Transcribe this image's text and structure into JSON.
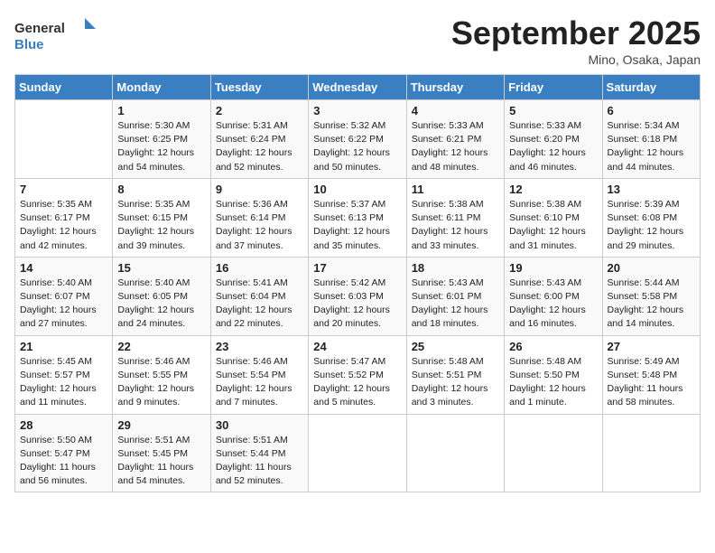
{
  "header": {
    "logo_text_general": "General",
    "logo_text_blue": "Blue",
    "month_title": "September 2025",
    "location": "Mino, Osaka, Japan"
  },
  "days_of_week": [
    "Sunday",
    "Monday",
    "Tuesday",
    "Wednesday",
    "Thursday",
    "Friday",
    "Saturday"
  ],
  "weeks": [
    [
      null,
      {
        "day": 1,
        "sunrise": "5:30 AM",
        "sunset": "6:25 PM",
        "daylight": "12 hours and 54 minutes."
      },
      {
        "day": 2,
        "sunrise": "5:31 AM",
        "sunset": "6:24 PM",
        "daylight": "12 hours and 52 minutes."
      },
      {
        "day": 3,
        "sunrise": "5:32 AM",
        "sunset": "6:22 PM",
        "daylight": "12 hours and 50 minutes."
      },
      {
        "day": 4,
        "sunrise": "5:33 AM",
        "sunset": "6:21 PM",
        "daylight": "12 hours and 48 minutes."
      },
      {
        "day": 5,
        "sunrise": "5:33 AM",
        "sunset": "6:20 PM",
        "daylight": "12 hours and 46 minutes."
      },
      {
        "day": 6,
        "sunrise": "5:34 AM",
        "sunset": "6:18 PM",
        "daylight": "12 hours and 44 minutes."
      }
    ],
    [
      {
        "day": 7,
        "sunrise": "5:35 AM",
        "sunset": "6:17 PM",
        "daylight": "12 hours and 42 minutes."
      },
      {
        "day": 8,
        "sunrise": "5:35 AM",
        "sunset": "6:15 PM",
        "daylight": "12 hours and 39 minutes."
      },
      {
        "day": 9,
        "sunrise": "5:36 AM",
        "sunset": "6:14 PM",
        "daylight": "12 hours and 37 minutes."
      },
      {
        "day": 10,
        "sunrise": "5:37 AM",
        "sunset": "6:13 PM",
        "daylight": "12 hours and 35 minutes."
      },
      {
        "day": 11,
        "sunrise": "5:38 AM",
        "sunset": "6:11 PM",
        "daylight": "12 hours and 33 minutes."
      },
      {
        "day": 12,
        "sunrise": "5:38 AM",
        "sunset": "6:10 PM",
        "daylight": "12 hours and 31 minutes."
      },
      {
        "day": 13,
        "sunrise": "5:39 AM",
        "sunset": "6:08 PM",
        "daylight": "12 hours and 29 minutes."
      }
    ],
    [
      {
        "day": 14,
        "sunrise": "5:40 AM",
        "sunset": "6:07 PM",
        "daylight": "12 hours and 27 minutes."
      },
      {
        "day": 15,
        "sunrise": "5:40 AM",
        "sunset": "6:05 PM",
        "daylight": "12 hours and 24 minutes."
      },
      {
        "day": 16,
        "sunrise": "5:41 AM",
        "sunset": "6:04 PM",
        "daylight": "12 hours and 22 minutes."
      },
      {
        "day": 17,
        "sunrise": "5:42 AM",
        "sunset": "6:03 PM",
        "daylight": "12 hours and 20 minutes."
      },
      {
        "day": 18,
        "sunrise": "5:43 AM",
        "sunset": "6:01 PM",
        "daylight": "12 hours and 18 minutes."
      },
      {
        "day": 19,
        "sunrise": "5:43 AM",
        "sunset": "6:00 PM",
        "daylight": "12 hours and 16 minutes."
      },
      {
        "day": 20,
        "sunrise": "5:44 AM",
        "sunset": "5:58 PM",
        "daylight": "12 hours and 14 minutes."
      }
    ],
    [
      {
        "day": 21,
        "sunrise": "5:45 AM",
        "sunset": "5:57 PM",
        "daylight": "12 hours and 11 minutes."
      },
      {
        "day": 22,
        "sunrise": "5:46 AM",
        "sunset": "5:55 PM",
        "daylight": "12 hours and 9 minutes."
      },
      {
        "day": 23,
        "sunrise": "5:46 AM",
        "sunset": "5:54 PM",
        "daylight": "12 hours and 7 minutes."
      },
      {
        "day": 24,
        "sunrise": "5:47 AM",
        "sunset": "5:52 PM",
        "daylight": "12 hours and 5 minutes."
      },
      {
        "day": 25,
        "sunrise": "5:48 AM",
        "sunset": "5:51 PM",
        "daylight": "12 hours and 3 minutes."
      },
      {
        "day": 26,
        "sunrise": "5:48 AM",
        "sunset": "5:50 PM",
        "daylight": "12 hours and 1 minute."
      },
      {
        "day": 27,
        "sunrise": "5:49 AM",
        "sunset": "5:48 PM",
        "daylight": "11 hours and 58 minutes."
      }
    ],
    [
      {
        "day": 28,
        "sunrise": "5:50 AM",
        "sunset": "5:47 PM",
        "daylight": "11 hours and 56 minutes."
      },
      {
        "day": 29,
        "sunrise": "5:51 AM",
        "sunset": "5:45 PM",
        "daylight": "11 hours and 54 minutes."
      },
      {
        "day": 30,
        "sunrise": "5:51 AM",
        "sunset": "5:44 PM",
        "daylight": "11 hours and 52 minutes."
      },
      null,
      null,
      null,
      null
    ]
  ]
}
